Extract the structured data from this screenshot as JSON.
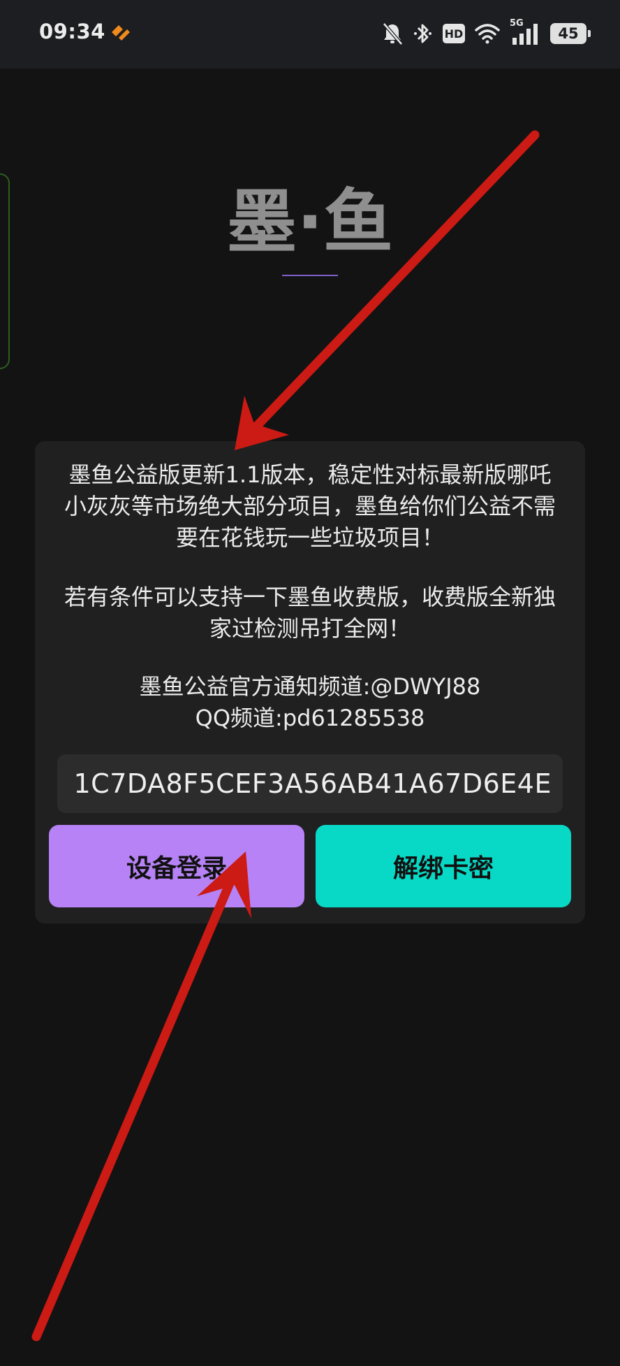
{
  "status_bar": {
    "time": "09:34",
    "hd_label": "HD",
    "network_label": "5G",
    "battery_level": "45",
    "icons": [
      "app-notification-icon",
      "bell-muted-icon",
      "bluetooth-icon",
      "hd-icon",
      "wifi-icon",
      "signal-5g-icon",
      "battery-icon"
    ]
  },
  "app": {
    "title": "墨·鱼"
  },
  "notice": {
    "paragraph_1": "墨鱼公益版更新1.1版本，稳定性对标最新版哪吒 小灰灰等市场绝大部分项目，墨鱼给你们公益不需要在花钱玩一些垃圾项目！",
    "paragraph_2": "若有条件可以支持一下墨鱼收费版，收费版全新独家过检测吊打全网！",
    "channel_line": "墨鱼公益官方通知频道:@DWYJ88",
    "qq_line": "QQ频道:pd61285538"
  },
  "device_key": {
    "value": "1C7DA8F5CEF3A56AB41A67D6E4E"
  },
  "buttons": {
    "login": "设备登录",
    "unbind": "解绑卡密"
  },
  "colors": {
    "login_button": "#b682f5",
    "unbind_button": "#08d9c6",
    "annotation_arrow": "#cc1a14",
    "background": "#131313",
    "card": "#202020"
  }
}
